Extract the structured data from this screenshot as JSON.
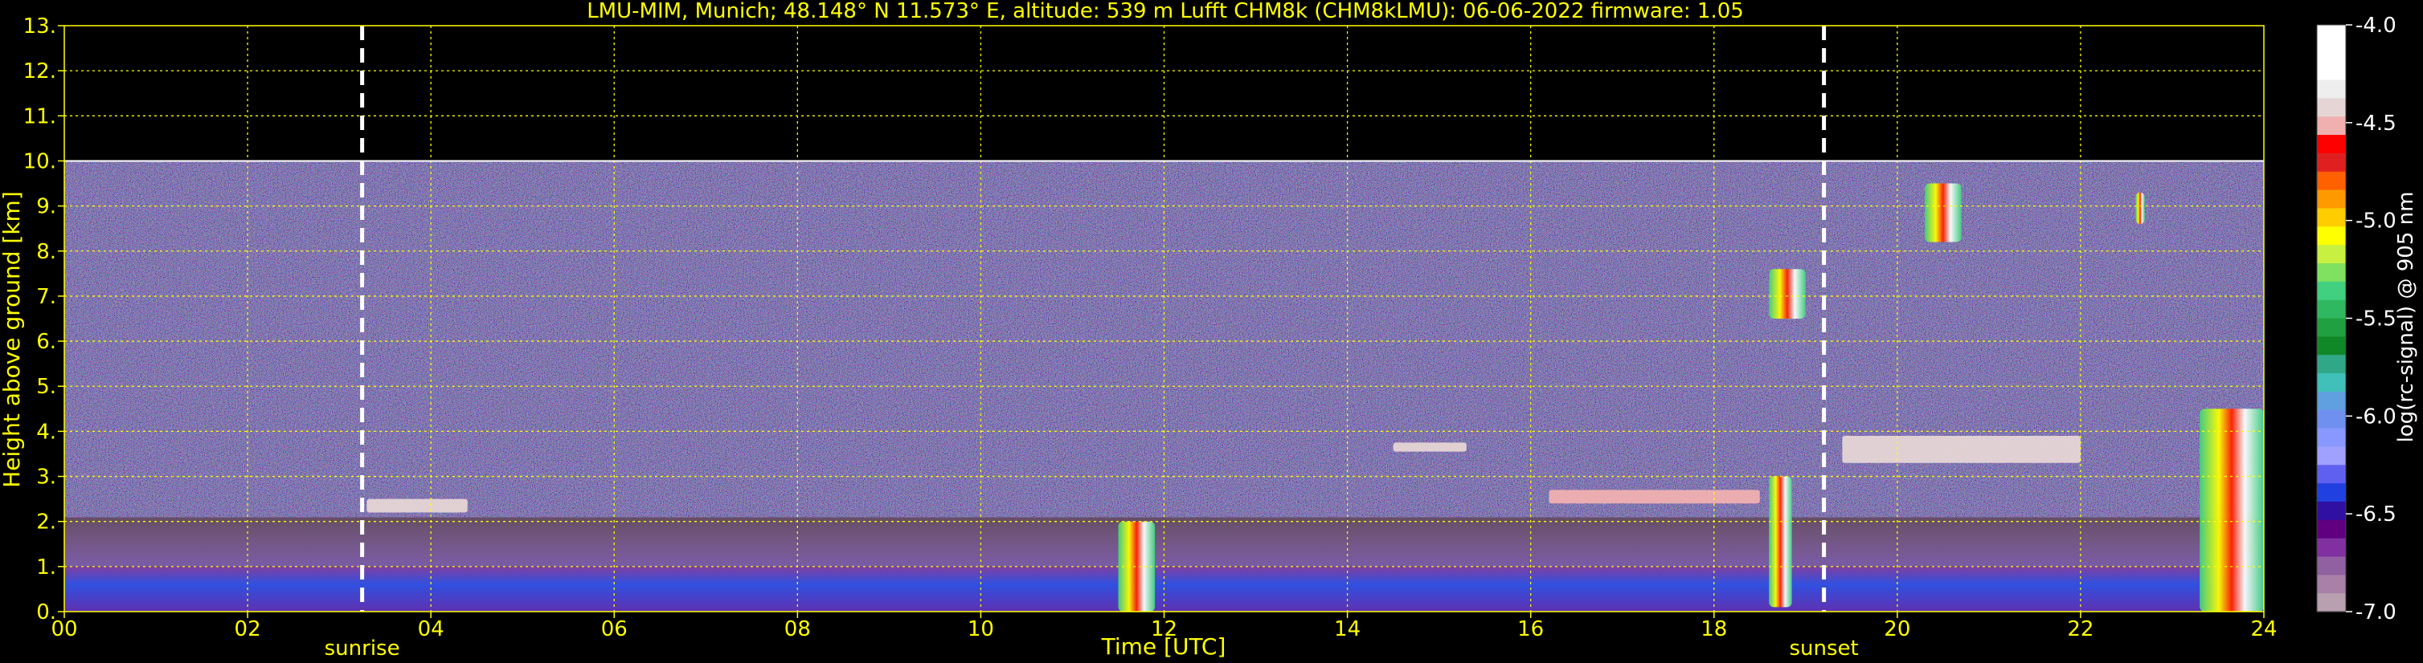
{
  "chart_data": {
    "type": "heatmap",
    "title": "LMU-MIM, Munich; 48.148° N 11.573° E, altitude: 539 m    Lufft CHM8k (CHM8kLMU): 06-06-2022    firmware: 1.05",
    "xlabel": "Time [UTC]",
    "ylabel": "Height above ground [km]",
    "xlim": [
      0,
      24
    ],
    "ylim": [
      0,
      13
    ],
    "x_ticks": [
      "00",
      "02",
      "04",
      "06",
      "08",
      "10",
      "12",
      "14",
      "16",
      "18",
      "20",
      "22",
      "24"
    ],
    "y_ticks": [
      "0.",
      "1.",
      "2.",
      "3.",
      "4.",
      "5.",
      "6.",
      "7.",
      "8.",
      "9.",
      "10.",
      "11.",
      "12.",
      "13."
    ],
    "grid": true,
    "grid_color": "#ffff00",
    "data_top_km": 10,
    "markers": [
      {
        "label": "sunrise",
        "x": 3.25
      },
      {
        "label": "sunset",
        "x": 19.2
      }
    ],
    "colorbar": {
      "label": "log(rc-signal) @ 905 nm",
      "range": [
        -7.0,
        -4.0
      ],
      "ticks": [
        "-4.0",
        "-4.5",
        "-5.0",
        "-5.5",
        "-6.0",
        "-6.5",
        "-7.0"
      ],
      "colors": [
        "#ffffff",
        "#ffffff",
        "#ffffff",
        "#eeeeee",
        "#e6d5d5",
        "#f0b0b0",
        "#ff0000",
        "#e02020",
        "#ff6000",
        "#ff9900",
        "#ffcc00",
        "#ffff00",
        "#c8f040",
        "#80e060",
        "#40d080",
        "#30b860",
        "#20a040",
        "#108828",
        "#30a888",
        "#40c0b8",
        "#60a0e0",
        "#7090f0",
        "#8898ff",
        "#a0a0ff",
        "#6060f0",
        "#2040e0",
        "#3010a0",
        "#600080",
        "#8030a0",
        "#9060a0",
        "#a880a8",
        "#b8a0b0"
      ]
    },
    "layers": [
      {
        "name": "boundary layer",
        "x": [
          0,
          24
        ],
        "y": [
          0,
          1.0
        ],
        "value": -6.3
      },
      {
        "name": "residual layer",
        "x": [
          0,
          24
        ],
        "y": [
          1.0,
          2.1
        ],
        "value": -6.7
      },
      {
        "name": "noise",
        "x": [
          0,
          24
        ],
        "y": [
          2.1,
          10.0
        ],
        "value": -6.6
      }
    ],
    "features": [
      {
        "name": "cloud",
        "x": [
          11.5,
          11.9
        ],
        "y": [
          0.0,
          2.0
        ],
        "value": -4.5
      },
      {
        "name": "cloud",
        "x": [
          18.6,
          18.85
        ],
        "y": [
          0.1,
          3.0
        ],
        "value": -5.0
      },
      {
        "name": "cloud",
        "x": [
          18.6,
          19.0
        ],
        "y": [
          6.5,
          7.6
        ],
        "value": -5.0
      },
      {
        "name": "cloud",
        "x": [
          23.3,
          24.0
        ],
        "y": [
          0.0,
          4.5
        ],
        "value": -4.6
      },
      {
        "name": "cloud",
        "x": [
          3.3,
          4.4
        ],
        "y": [
          2.2,
          2.5
        ],
        "value": -4.4
      },
      {
        "name": "cloud",
        "x": [
          14.5,
          15.3
        ],
        "y": [
          3.55,
          3.75
        ],
        "value": -4.4
      },
      {
        "name": "cloud",
        "x": [
          19.4,
          22.0
        ],
        "y": [
          3.3,
          3.9
        ],
        "value": -4.4
      },
      {
        "name": "cloud",
        "x": [
          16.2,
          18.5
        ],
        "y": [
          2.4,
          2.7
        ],
        "value": -4.5
      },
      {
        "name": "cloud",
        "x": [
          20.3,
          20.7
        ],
        "y": [
          8.2,
          9.5
        ],
        "value": -5.3
      },
      {
        "name": "cloud",
        "x": [
          22.6,
          22.7
        ],
        "y": [
          8.6,
          9.3
        ],
        "value": -5.5
      }
    ]
  }
}
